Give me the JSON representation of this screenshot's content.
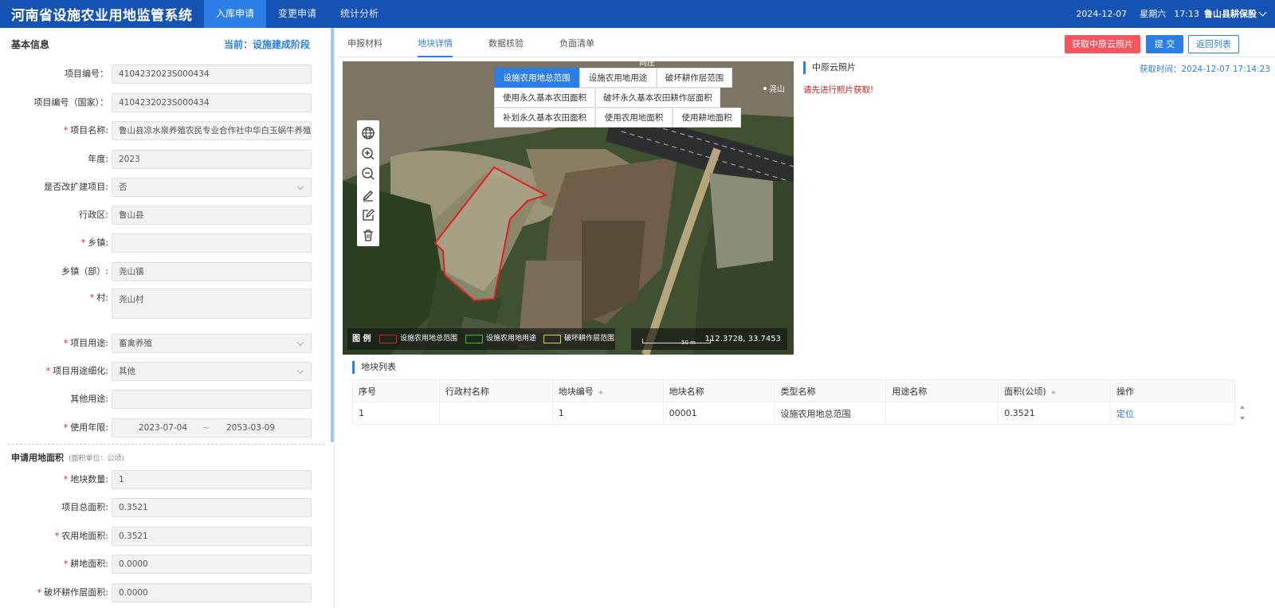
{
  "app": {
    "title": "河南省设施农业用地监管系统"
  },
  "nav": {
    "tabs": [
      {
        "label": "入库申请"
      },
      {
        "label": "变更申请"
      },
      {
        "label": "统计分析"
      }
    ]
  },
  "header_right": {
    "date": "2024-12-07",
    "weekday": "星期六",
    "time": "17:13",
    "org": "鲁山县耕保股"
  },
  "basic": {
    "title": "基本信息",
    "stage": "当前：设施建成阶段",
    "fields": [
      {
        "label": "项目编号：",
        "value": "4104232023S000434",
        "required": false
      },
      {
        "label": "项目编号（国家）：",
        "value": "4104232023S000434",
        "required": false
      },
      {
        "label": "项目名称:",
        "value": "鲁山县凉水泉养殖农民专业合作社中华白玉蜗牛养殖",
        "required": true
      },
      {
        "label": "年度:",
        "value": "2023",
        "required": false
      },
      {
        "label": "是否改扩建项目:",
        "value": "否",
        "required": false
      },
      {
        "label": "行政区:",
        "value": "鲁山县",
        "required": false
      },
      {
        "label": "乡镇:",
        "value": "",
        "required": true
      },
      {
        "label": "乡镇（部）:",
        "value": "尧山镇",
        "required": false
      },
      {
        "label": "村:",
        "value": "尧山村",
        "required": true
      },
      {
        "label": "项目用途:",
        "value": "畜禽养殖",
        "required": true
      },
      {
        "label": "项目用途细化:",
        "value": "其他",
        "required": true
      },
      {
        "label": "其他用途:",
        "value": "",
        "required": false
      },
      {
        "label": "使用年限:",
        "value": "",
        "required": true
      }
    ],
    "years": {
      "start": "2023-07-04",
      "sep": "~",
      "end": "2053-03-09"
    }
  },
  "area": {
    "title": "申请用地面积",
    "unit": "(面积单位：公顷)",
    "fields": [
      {
        "label": "地块数量:",
        "value": "1",
        "required": true
      },
      {
        "label": "项目总面积:",
        "value": "0.3521",
        "required": false
      },
      {
        "label": "农用地面积:",
        "value": "0.3521",
        "required": true
      },
      {
        "label": "耕地面积:",
        "value": "0.0000",
        "required": true
      },
      {
        "label": "破坏耕作层面积:",
        "value": "0.0000",
        "required": true
      }
    ]
  },
  "content_tabs": [
    {
      "label": "申报材料"
    },
    {
      "label": "地块详情"
    },
    {
      "label": "数据核验"
    },
    {
      "label": "负面清单"
    }
  ],
  "actions": {
    "fetch": "获取中原云照片",
    "submit": "提 交",
    "back": "返回列表"
  },
  "map": {
    "layer_buttons": [
      {
        "label": "设施农用地总范围"
      },
      {
        "label": "设施农用地用途"
      },
      {
        "label": "破坏耕作层范围"
      },
      {
        "label": "使用永久基本农田面积"
      },
      {
        "label": "破坏永久基本农田耕作层面积"
      },
      {
        "label": "补划永久基本农田面积"
      },
      {
        "label": "使用农用地面积"
      },
      {
        "label": "使用耕地面积"
      }
    ],
    "tools": [
      {
        "icon": "globe-icon"
      },
      {
        "icon": "zoom-in-icon"
      },
      {
        "icon": "zoom-out-icon"
      },
      {
        "icon": "pencil-icon"
      },
      {
        "icon": "edit-icon"
      },
      {
        "icon": "trash-icon"
      }
    ],
    "legend_title": "图 例",
    "legend": [
      {
        "label": "设施农用地总范围",
        "color": "#e02020"
      },
      {
        "label": "设施农用地用途",
        "color": "#22cc33"
      },
      {
        "label": "破坏耕作层范围",
        "color": "#e8d020"
      }
    ],
    "scale": "50 m",
    "coords": "112.3728, 33.7453",
    "labels": [
      "尧山",
      "向庄"
    ]
  },
  "cloud": {
    "title": "中原云照片",
    "time_label": "获取时间：",
    "time": "2024-12-07 17:14:23",
    "warning": "请先进行照片获取!"
  },
  "parcels": {
    "title": "地块列表",
    "columns": [
      "序号",
      "行政村名称",
      "地块编号",
      "地块名称",
      "类型名称",
      "用途名称",
      "面积(公顷)",
      "操作"
    ],
    "rows": [
      {
        "no": "1",
        "village": "",
        "code": "1",
        "name": "00001",
        "type": "设施农用地总范围",
        "use": "",
        "area": "0.3521",
        "op": "定位"
      }
    ]
  }
}
